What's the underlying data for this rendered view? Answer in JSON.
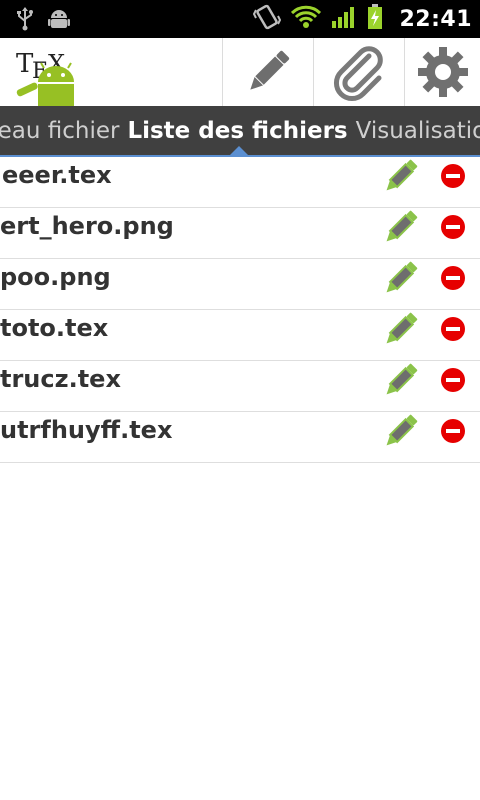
{
  "status_bar": {
    "time": "22:41",
    "icons": [
      "usb-icon",
      "android-debug-icon",
      "vibrate-icon",
      "wifi-icon",
      "signal-icon",
      "battery-charging-icon"
    ]
  },
  "action_bar": {
    "logo_text": "TEX",
    "actions": [
      "pencil-icon",
      "paperclip-icon",
      "gear-icon"
    ]
  },
  "tabs": [
    {
      "label": "veau fichier",
      "active": false
    },
    {
      "label": "Liste des fichiers",
      "active": true
    },
    {
      "label": "Visualisation",
      "active": false
    }
  ],
  "files": [
    {
      "name": "eeer.tex"
    },
    {
      "name": "ert_hero.png"
    },
    {
      "name": "poo.png"
    },
    {
      "name": "toto.tex"
    },
    {
      "name": "trucz.tex"
    },
    {
      "name": "utrfhuyff.tex"
    }
  ],
  "colors": {
    "accent": "#5b8fd1",
    "edit_green": "#8bc34a",
    "delete_red": "#e60000",
    "status_green": "#9bd32c"
  }
}
